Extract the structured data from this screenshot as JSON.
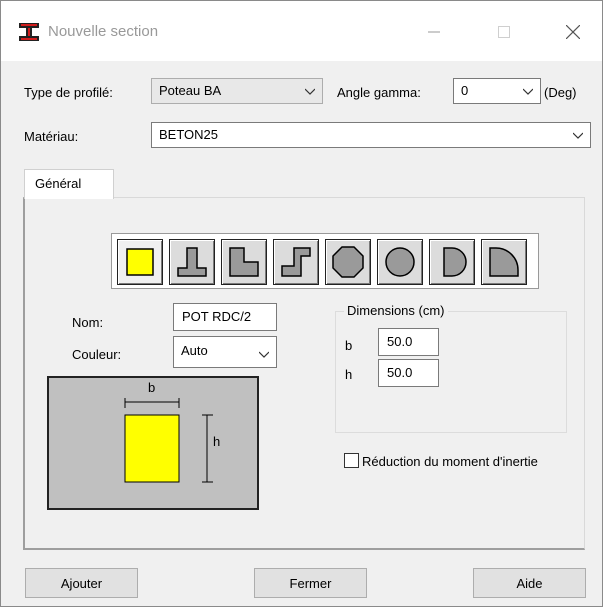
{
  "window": {
    "title": "Nouvelle section"
  },
  "titlebar": {
    "minimize_icon": "minimize-icon",
    "maximize_icon": "maximize-icon",
    "close_icon": "close-icon"
  },
  "header": {
    "profile_type_label": "Type de profilé:",
    "profile_type_value": "Poteau BA",
    "angle_label": "Angle gamma:",
    "angle_value": "0",
    "angle_unit": "(Deg)",
    "material_label": "Matériau:",
    "material_value": "BETON25"
  },
  "tabs": [
    {
      "label": "Général",
      "selected": true
    }
  ],
  "shapes": [
    {
      "name": "rectangle",
      "selected": true
    },
    {
      "name": "t-section",
      "selected": false
    },
    {
      "name": "l-section",
      "selected": false
    },
    {
      "name": "z-section",
      "selected": false
    },
    {
      "name": "octagon",
      "selected": false
    },
    {
      "name": "circle",
      "selected": false
    },
    {
      "name": "half-circle",
      "selected": false
    },
    {
      "name": "quarter-circle",
      "selected": false
    }
  ],
  "form": {
    "name_label": "Nom:",
    "name_value": "POT RDC/2",
    "color_label": "Couleur:",
    "color_value": "Auto"
  },
  "dimensions": {
    "group_title": "Dimensions (cm)",
    "b_label": "b",
    "b_value": "50.0",
    "h_label": "h",
    "h_value": "50.0"
  },
  "preview": {
    "b_label": "b",
    "h_label": "h",
    "fill_color": "#ffff00"
  },
  "inertia": {
    "label": "Réduction du moment d'inertie",
    "checked": false
  },
  "buttons": {
    "add": "Ajouter",
    "close": "Fermer",
    "help": "Aide"
  }
}
